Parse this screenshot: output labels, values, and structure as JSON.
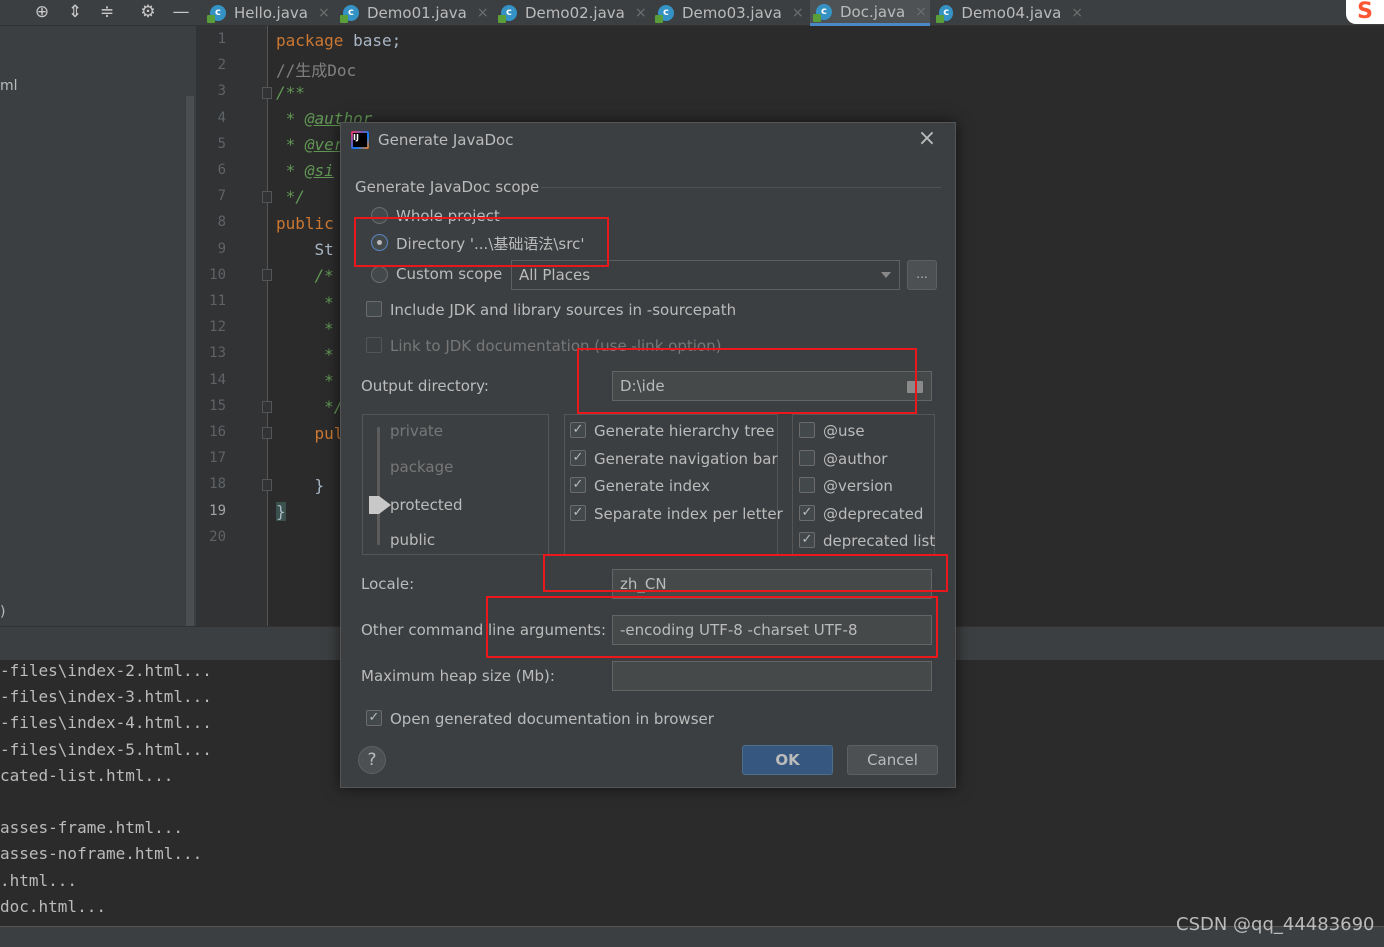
{
  "tabs": [
    {
      "label": "Hello.java",
      "active": false
    },
    {
      "label": "Demo01.java",
      "active": false
    },
    {
      "label": "Demo02.java",
      "active": false
    },
    {
      "label": "Demo03.java",
      "active": false
    },
    {
      "label": "Doc.java",
      "active": true
    },
    {
      "label": "Demo04.java",
      "active": false
    }
  ],
  "toolbar": {
    "icons": [
      "crosshair-icon",
      "expand-all-icon",
      "collapse-all-icon",
      "gear-icon",
      "minimize-icon"
    ]
  },
  "project_panel": {
    "item_1": "ml",
    "item_2": ")"
  },
  "editor": {
    "line_numbers": [
      "1",
      "2",
      "3",
      "4",
      "5",
      "6",
      "7",
      "8",
      "9",
      "10",
      "11",
      "12",
      "13",
      "14",
      "15",
      "16",
      "17",
      "18",
      "19",
      "20"
    ],
    "current_line": "19",
    "code": {
      "l1_kw": "package",
      "l1_rest": " base;",
      "l2": "//生成Doc",
      "l3": "/**",
      "l4_star": " * ",
      "l4_tag": "@author",
      "l5_star": " * ",
      "l5_tag": "@ver",
      "l6_star": " * ",
      "l6_tag": "@si",
      "l7": " */",
      "l8": "public",
      "l9": "    St",
      "l10": "    /*",
      "l11": "     *",
      "l12": "     *",
      "l13": "     *",
      "l14": "     *",
      "l15": "     */",
      "l16": "    pul",
      "l18": "    }",
      "l19": "}"
    }
  },
  "console": {
    "lines": [
      "-files\\index-2.html...",
      "-files\\index-3.html...",
      "-files\\index-4.html...",
      "-files\\index-5.html...",
      "cated-list.html...",
      "",
      "asses-frame.html...",
      "asses-noframe.html...",
      ".html...",
      "doc.html..."
    ]
  },
  "watermark": "CSDN @qq_44483690",
  "dialog": {
    "title": "Generate JavaDoc",
    "scope_header": "Generate JavaDoc scope",
    "scope_whole": "Whole project",
    "scope_directory": "Directory '...\\基础语法\\src'",
    "scope_custom": "Custom scope",
    "custom_scope_value": "All Places",
    "browse_label": "...",
    "include_jdk": "Include JDK and library sources in -sourcepath",
    "link_jdk": "Link to JDK documentation (use -link option)",
    "output_dir_label": "Output directory:",
    "output_dir_value": "D:\\ide",
    "visibility": {
      "private": "private",
      "package": "package",
      "protected": "protected",
      "public": "public",
      "selected": "protected"
    },
    "generate_options": [
      {
        "label": "Generate hierarchy tree",
        "checked": true
      },
      {
        "label": "Generate navigation bar",
        "checked": true
      },
      {
        "label": "Generate index",
        "checked": true
      },
      {
        "label": "Separate index per letter",
        "checked": true
      }
    ],
    "tag_options": [
      {
        "label": "@use",
        "checked": false
      },
      {
        "label": "@author",
        "checked": false
      },
      {
        "label": "@version",
        "checked": false
      },
      {
        "label": "@deprecated",
        "checked": true
      },
      {
        "label": "deprecated list",
        "checked": true
      }
    ],
    "locale_label": "Locale:",
    "locale_value": "zh_CN",
    "cmdline_label": "Other command line arguments:",
    "cmdline_value": "-encoding UTF-8 -charset UTF-8",
    "heap_label": "Maximum heap size (Mb):",
    "heap_value": "",
    "open_in_browser": "Open generated documentation in browser",
    "ok": "OK",
    "cancel": "Cancel",
    "help": "?",
    "close": "×"
  },
  "colors": {
    "annotation_red": "#e8181c",
    "ok_button": "#365880",
    "keyword": "#cc7832",
    "doc_comment": "#629755"
  }
}
